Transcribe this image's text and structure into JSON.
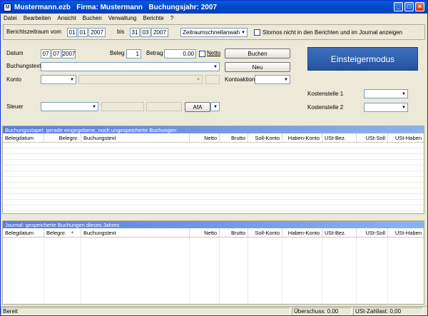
{
  "titlebar": {
    "icon_letter": "M",
    "title": "Mustermann.ezb   Firma: Mustermann   Buchungsjahr: 2007",
    "min": "_",
    "max": "□",
    "close": "×"
  },
  "menu": [
    {
      "label": "Datei"
    },
    {
      "label": "Bearbeiten"
    },
    {
      "label": "Ansicht"
    },
    {
      "label": "Buchen"
    },
    {
      "label": "Verwaltung"
    },
    {
      "label": "Berichte"
    },
    {
      "label": "?"
    }
  ],
  "filter": {
    "period_label": "Berichtszeitraum vom",
    "from_day": "01",
    "from_month": "01",
    "from_year": "2007",
    "bis_label": "bis",
    "to_day": "31",
    "to_month": "03",
    "to_year": "2007",
    "quick_select": "Zeitraumschnellanwahl",
    "storno_label": "Stornos nicht in den Berichten und im Journal anzeigen"
  },
  "form": {
    "datum_label": "Datum",
    "datum_day": "07",
    "datum_month": "07",
    "datum_year": "2007",
    "beleg_label": "Beleg",
    "beleg_value": "1",
    "betrag_label": "Betrag",
    "betrag_value": "0,00",
    "netto_label": "Netto",
    "buchen_button": "Buchen",
    "neu_button": "Neu",
    "buchungstext_label": "Buchungstext",
    "konto_label": "Konto",
    "kontoaktion_label": "Kontoaktion",
    "steuer_label": "Steuer",
    "afa_value": "AfA",
    "mode_button": "Einsteigermodus",
    "kostenstelle1_label": "Kostenstelle 1",
    "kostenstelle2_label": "Kostenstelle 2"
  },
  "stapel": {
    "title": "Buchungsstapel: gerade eingegebene, noch ungespeicherte Buchungen",
    "columns": [
      "Belegdatum",
      "Belegnr.",
      "Buchungstext",
      "Netto",
      "Brutto",
      "Soll-Konto",
      "Haben-Konto",
      "USt-Bez.",
      "USt-Soll",
      "USt-Haben"
    ]
  },
  "journal": {
    "title": "Journal: gespeicherte Buchungen dieses Jahres",
    "columns": [
      "Belegdatum",
      "Belegnr.",
      "Buchungstext",
      "Netto",
      "Brutto",
      "Soll-Konto",
      "Haben-Konto",
      "USt-Bez.",
      "USt-Soll",
      "USt-Haben"
    ],
    "sort_icon": "▲"
  },
  "status": {
    "ready": "Bereit",
    "ueberschuss": "Überschuss: 0,00",
    "ust_zahllast": "USt-Zahllast: 0,00"
  }
}
